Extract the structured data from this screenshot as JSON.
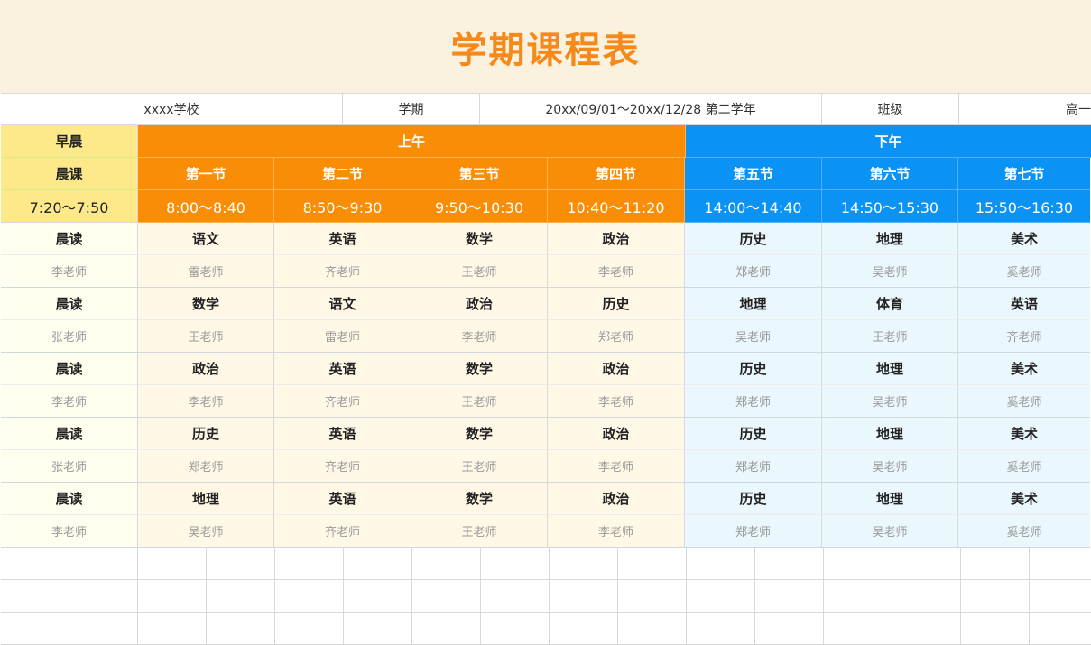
{
  "title": "学期课程表",
  "info": {
    "school": "xxxx学校",
    "term_label": "学期",
    "term_value": "20xx/09/01～20xx/12/28  第二学年",
    "class_label": "班级",
    "class_value": "高一"
  },
  "header": {
    "early_label": "早晨",
    "am_label": "上午",
    "pm_label": "下午",
    "periods": [
      {
        "name": "晨课",
        "time": "7:20～7:50"
      },
      {
        "name": "第一节",
        "time": "8:00～8:40"
      },
      {
        "name": "第二节",
        "time": "8:50～9:30"
      },
      {
        "name": "第三节",
        "time": "9:50～10:30"
      },
      {
        "name": "第四节",
        "time": "10:40～11:20"
      },
      {
        "name": "第五节",
        "time": "14:00～14:40"
      },
      {
        "name": "第六节",
        "time": "14:50～15:30"
      },
      {
        "name": "第七节",
        "time": "15:50～16:30"
      }
    ]
  },
  "rows": [
    [
      [
        "晨读",
        "李老师"
      ],
      [
        "语文",
        "雷老师"
      ],
      [
        "英语",
        "齐老师"
      ],
      [
        "数学",
        "王老师"
      ],
      [
        "政治",
        "李老师"
      ],
      [
        "历史",
        "郑老师"
      ],
      [
        "地理",
        "吴老师"
      ],
      [
        "美术",
        "奚老师"
      ]
    ],
    [
      [
        "晨读",
        "张老师"
      ],
      [
        "数学",
        "王老师"
      ],
      [
        "语文",
        "雷老师"
      ],
      [
        "政治",
        "李老师"
      ],
      [
        "历史",
        "郑老师"
      ],
      [
        "地理",
        "吴老师"
      ],
      [
        "体育",
        "王老师"
      ],
      [
        "英语",
        "齐老师"
      ]
    ],
    [
      [
        "晨读",
        "李老师"
      ],
      [
        "政治",
        "李老师"
      ],
      [
        "英语",
        "齐老师"
      ],
      [
        "数学",
        "王老师"
      ],
      [
        "政治",
        "李老师"
      ],
      [
        "历史",
        "郑老师"
      ],
      [
        "地理",
        "吴老师"
      ],
      [
        "美术",
        "奚老师"
      ]
    ],
    [
      [
        "晨读",
        "张老师"
      ],
      [
        "历史",
        "郑老师"
      ],
      [
        "英语",
        "齐老师"
      ],
      [
        "数学",
        "王老师"
      ],
      [
        "政治",
        "李老师"
      ],
      [
        "历史",
        "郑老师"
      ],
      [
        "地理",
        "吴老师"
      ],
      [
        "美术",
        "奚老师"
      ]
    ],
    [
      [
        "晨读",
        "李老师"
      ],
      [
        "地理",
        "吴老师"
      ],
      [
        "英语",
        "齐老师"
      ],
      [
        "数学",
        "王老师"
      ],
      [
        "政治",
        "李老师"
      ],
      [
        "历史",
        "郑老师"
      ],
      [
        "地理",
        "吴老师"
      ],
      [
        "美术",
        "奚老师"
      ]
    ]
  ],
  "colors": {
    "title": "#f5891a",
    "morning": "#fde98a",
    "am": "#f98d05",
    "pm": "#0b92f5"
  }
}
